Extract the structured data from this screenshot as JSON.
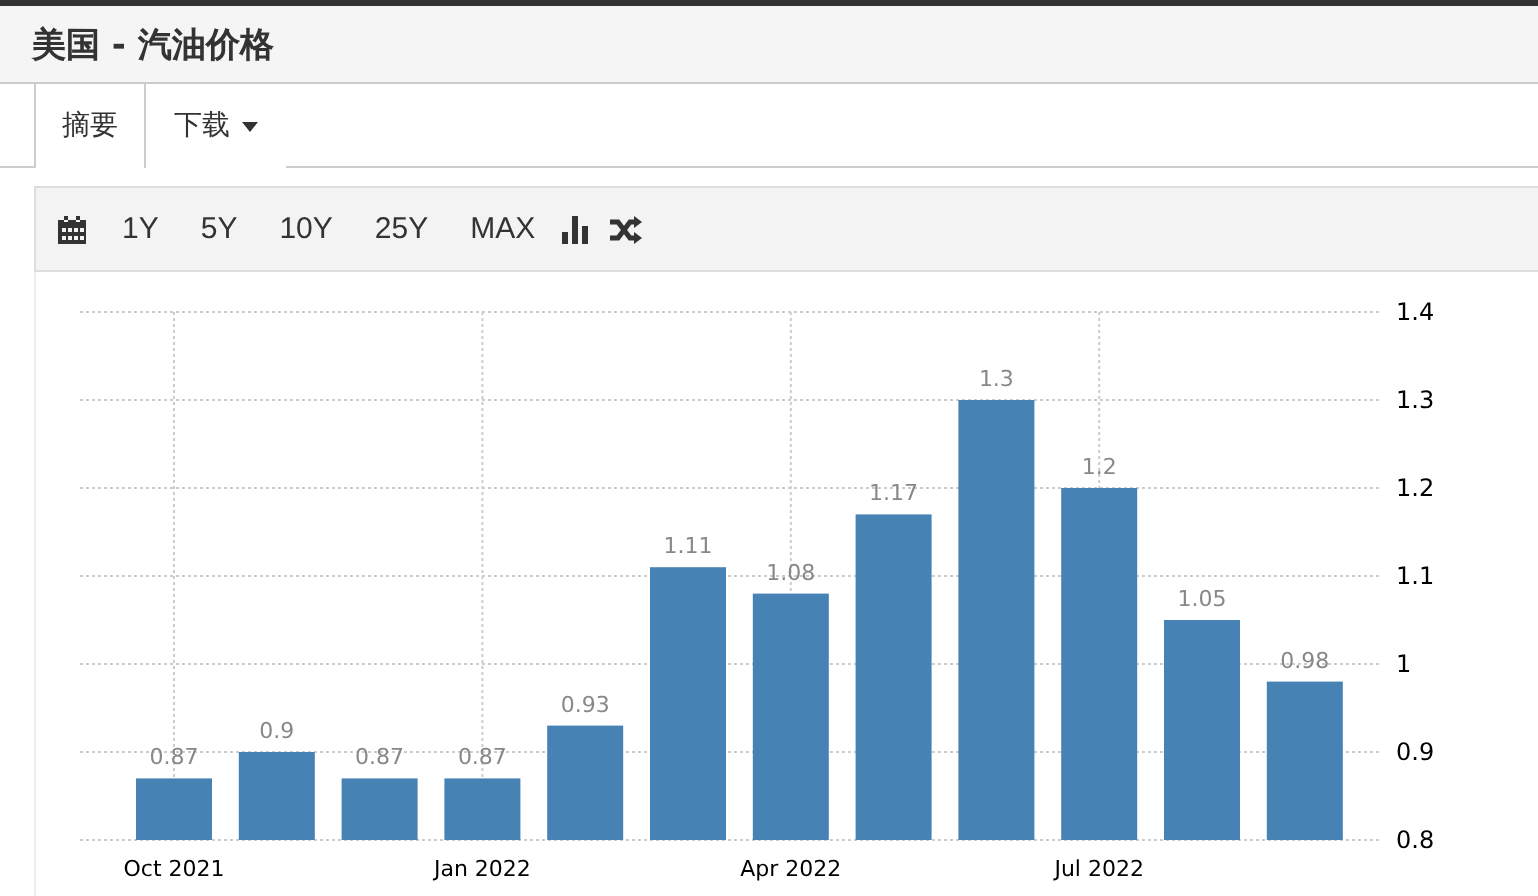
{
  "header": {
    "title": "美国 - 汽油价格"
  },
  "tabs": [
    {
      "label": "摘要",
      "selected": true
    },
    {
      "label": "下载",
      "selected": false,
      "dropdown": true
    }
  ],
  "toolbar": {
    "ranges": [
      "1Y",
      "5Y",
      "10Y",
      "25Y",
      "MAX"
    ]
  },
  "chart": {
    "chart_data": {
      "type": "bar",
      "categories": [
        "Oct 2021",
        null,
        null,
        "Jan 2022",
        null,
        null,
        "Apr 2022",
        null,
        null,
        "Jul 2022",
        null,
        null
      ],
      "series": [
        {
          "color": "#4682b4",
          "values": [
            0.87,
            0.9,
            0.87,
            0.87,
            0.93,
            1.11,
            1.08,
            1.17,
            1.3,
            1.2,
            1.05,
            0.98
          ]
        }
      ],
      "ylim": [
        0.8,
        1.4
      ],
      "grid": true,
      "yticks": [
        {
          "value": 0.8,
          "label": "0.8"
        },
        {
          "value": 0.9,
          "label": "0.9"
        },
        {
          "value": 1,
          "label": "1"
        },
        {
          "value": 1.1,
          "label": "1.1"
        },
        {
          "value": 1.2,
          "label": "1.2"
        },
        {
          "value": 1.3,
          "label": "1.3"
        },
        {
          "value": 1.4,
          "label": "1.4"
        }
      ],
      "value_labels": [
        "0.87",
        "0.9",
        "0.87",
        "0.87",
        "0.93",
        "1.11",
        "1.08",
        "1.17",
        "1.3",
        "1.2",
        "1.05",
        "0.98"
      ]
    }
  }
}
